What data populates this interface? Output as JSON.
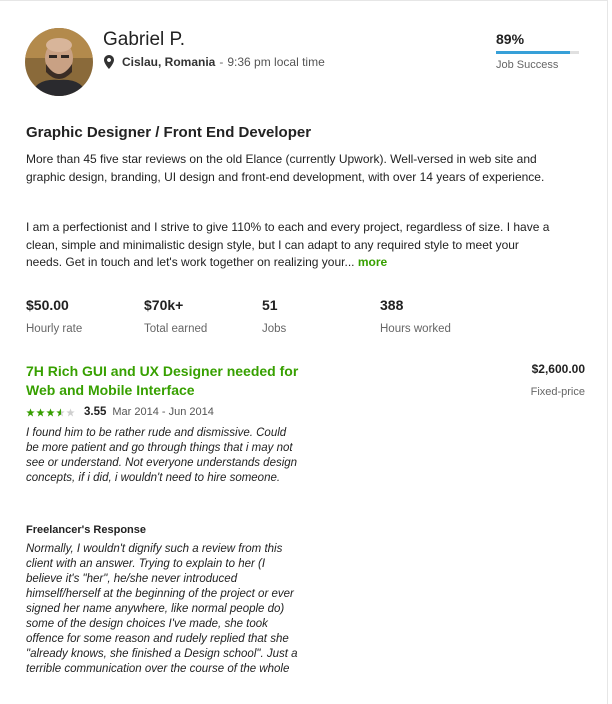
{
  "profile": {
    "name": "Gabriel P.",
    "location": "Cislau, Romania",
    "separator": "-",
    "local_time": "9:36 pm local time",
    "job_success_pct": "89%",
    "job_success_value": 0.89,
    "job_success_label": "Job Success",
    "colors": {
      "accent_green": "#37a000",
      "progress_blue": "#37a0d8"
    }
  },
  "overview": {
    "title": "Graphic Designer / Front End Developer",
    "paragraph1": "More than 45 five star reviews on the old Elance (currently Upwork). Well-versed in web site and graphic design, branding, UI design and front-end development, with over 14 years of experience.",
    "paragraph2": "I am a perfectionist and I strive to give 110% to each and every project, regardless of size. I have a clean, simple and minimalistic design style, but I can adapt to any required style to meet your needs. Get in touch and let's work together on realizing your...",
    "more_link": "more"
  },
  "stats": [
    {
      "value": "$50.00",
      "label": "Hourly rate"
    },
    {
      "value": "$70k+",
      "label": "Total earned"
    },
    {
      "value": "51",
      "label": "Jobs"
    },
    {
      "value": "388",
      "label": "Hours worked"
    }
  ],
  "job": {
    "title": "7H Rich GUI and UX Designer needed for Web and Mobile Interface",
    "amount": "$2,600.00",
    "price_type": "Fixed-price",
    "rating": "3.55",
    "rating_value": 3.55,
    "dates": "Mar 2014 - Jun 2014",
    "review": "I found him to be rather rude and dismissive. Could be more patient and go through things that i may not see or understand. Not everyone understands design concepts, if i did, i wouldn't need to hire someone.",
    "response_heading": "Freelancer's Response",
    "response": "Normally, I wouldn't dignify such a review from this client with an answer. Trying to explain to her (I believe it's \"her\", he/she never introduced himself/herself at the beginning of the project or ever signed her name anywhere, like normal people do) some of the design choices I've made, she took offence for some reason and rudely replied that she \"already knows, she finished a Design school\". Just a terrible communication over the course of the whole"
  },
  "icons": {
    "location": "map-pin-icon",
    "star": "star-icon"
  }
}
